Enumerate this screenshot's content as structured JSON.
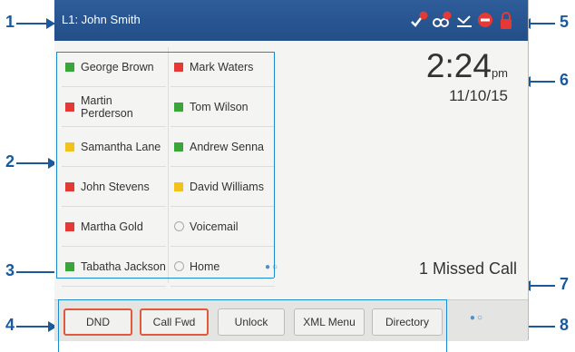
{
  "status_bar": {
    "line_label": "L1: John Smith",
    "icons": [
      "voicemail-count-icon",
      "missed-call-count-icon",
      "missed-call-icon",
      "dnd-icon",
      "lock-icon"
    ],
    "icon_badge_color": "#e53935"
  },
  "contacts": {
    "column1": [
      {
        "name": "George Brown",
        "status": "available"
      },
      {
        "name": "Martin Perderson",
        "status": "busy"
      },
      {
        "name": "Samantha Lane",
        "status": "away"
      },
      {
        "name": "John Stevens",
        "status": "busy"
      },
      {
        "name": "Martha Gold",
        "status": "busy"
      },
      {
        "name": "Tabatha Jackson",
        "status": "available"
      }
    ],
    "column2": [
      {
        "name": "Mark Waters",
        "status": "busy"
      },
      {
        "name": "Tom Wilson",
        "status": "available"
      },
      {
        "name": "Andrew Senna",
        "status": "available"
      },
      {
        "name": "David Williams",
        "status": "away"
      },
      {
        "name": "Voicemail",
        "status": "none"
      },
      {
        "name": "Home",
        "status": "none"
      }
    ]
  },
  "status_colors": {
    "available": "#3aa63a",
    "busy": "#e53935",
    "away": "#f2c21b"
  },
  "clock": {
    "time": "2:24",
    "ampm": "pm",
    "date": "11/10/15"
  },
  "missed_calls": "1 Missed Call",
  "page_indicator": "●○",
  "softkeys": [
    {
      "label": "DND",
      "highlighted": true
    },
    {
      "label": "Call Fwd",
      "highlighted": true
    },
    {
      "label": "Unlock",
      "highlighted": false
    },
    {
      "label": "XML Menu",
      "highlighted": false
    },
    {
      "label": "Directory",
      "highlighted": false
    }
  ],
  "softkey_page_indicator": "●○",
  "callouts": [
    "1",
    "2",
    "3",
    "4",
    "5",
    "6",
    "7",
    "8"
  ]
}
